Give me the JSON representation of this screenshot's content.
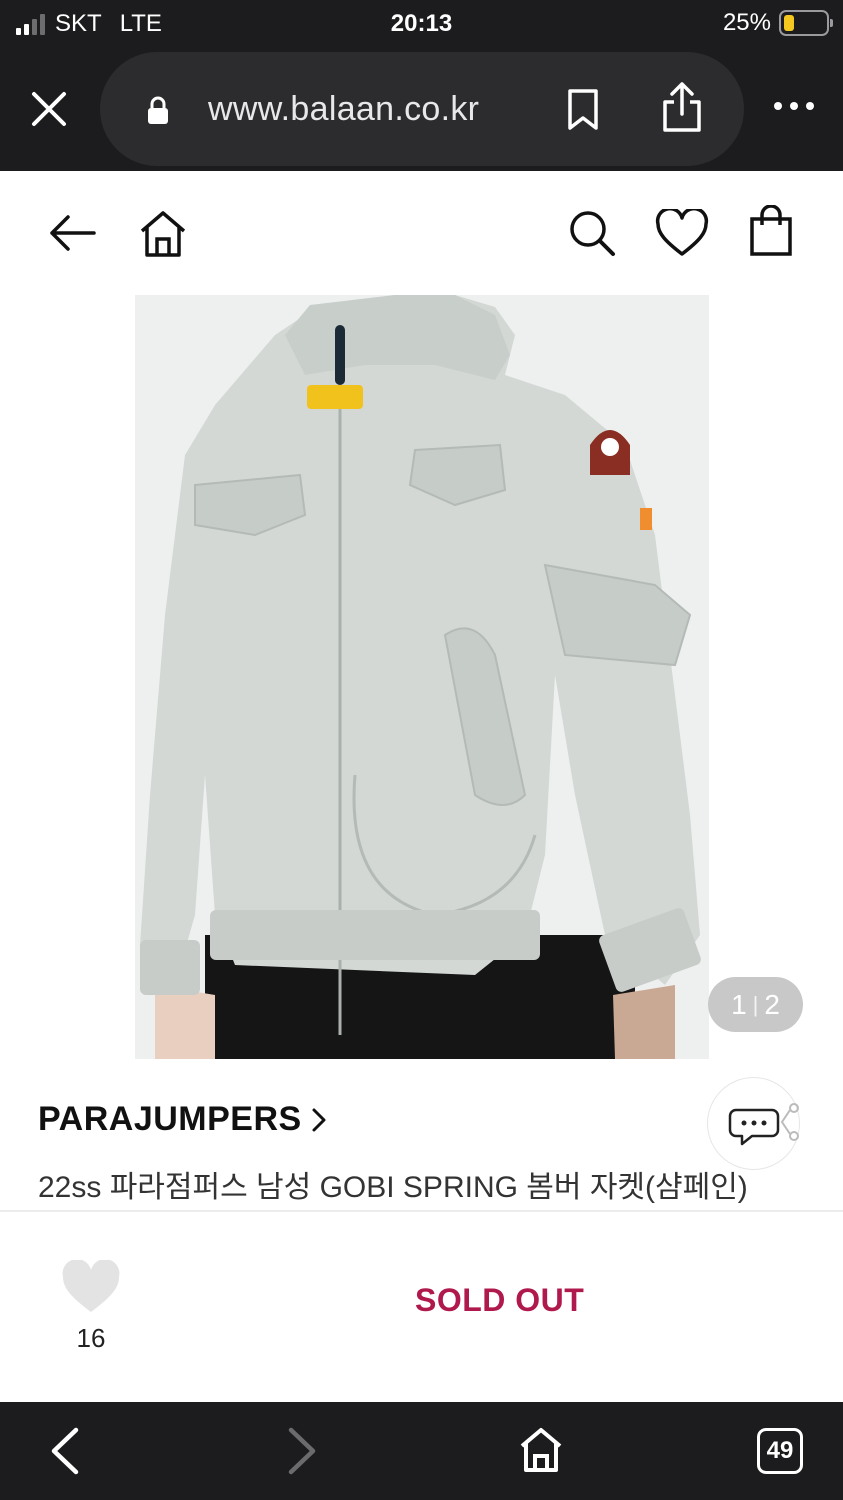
{
  "status_bar": {
    "carrier": "SKT",
    "network": "LTE",
    "time": "20:13",
    "battery": "25%",
    "battery_level": 0.25,
    "battery_color": "#f4c81f"
  },
  "browser": {
    "url": "www.balaan.co.kr",
    "icons": [
      "close-icon",
      "lock-icon",
      "bookmark-icon",
      "share-icon",
      "more-icon"
    ]
  },
  "site_header": {
    "icons": [
      "back-arrow-icon",
      "home-icon",
      "search-icon",
      "heart-icon",
      "shopping-bag-icon"
    ]
  },
  "product": {
    "image_counter": {
      "current": "1",
      "separator": "|",
      "total": "2"
    },
    "brand": "PARAJUMPERS",
    "title": "22ss 파라점퍼스 남성 GOBI SPRING 봄버 자켓(샴페인)"
  },
  "actions": {
    "like_count": "16",
    "status_label": "SOLD OUT",
    "status_color": "#b0194d"
  },
  "bottom_toolbar": {
    "tab_count": "49",
    "icons": [
      "back-icon",
      "forward-icon",
      "home-icon",
      "tabs-icon"
    ]
  }
}
